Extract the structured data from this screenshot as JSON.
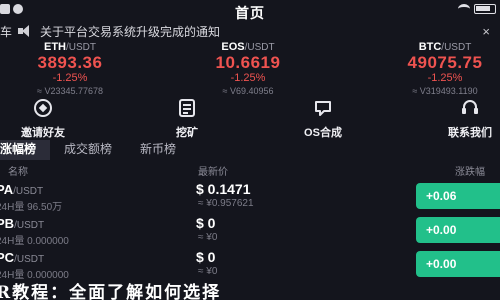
{
  "header": {
    "title": "首页"
  },
  "notice": {
    "prefix": "车",
    "text": "关于平台交易系统升级完成的通知"
  },
  "ticker": [
    {
      "base": "ETH",
      "quote": "/USDT",
      "price": "3893.36",
      "change": "-1.25%",
      "volume": "≈ V23345.77678"
    },
    {
      "base": "EOS",
      "quote": "/USDT",
      "price": "10.6619",
      "change": "-1.25%",
      "volume": "≈ V69.40956"
    },
    {
      "base": "BTC",
      "quote": "/USDT",
      "price": "49075.75",
      "change": "-1.25%",
      "volume": "≈ V319493.1190"
    }
  ],
  "shortcuts": [
    {
      "label": "邀请好友",
      "icon": "invite-icon"
    },
    {
      "label": "挖矿",
      "icon": "mining-icon"
    },
    {
      "label": "OS合成",
      "icon": "synthesis-icon"
    },
    {
      "label": "联系我们",
      "icon": "contact-icon"
    }
  ],
  "tabs": [
    {
      "label": "涨幅榜",
      "active": true
    },
    {
      "label": "成交额榜",
      "active": false
    },
    {
      "label": "新币榜",
      "active": false
    }
  ],
  "list_header": {
    "name": "名称",
    "price": "最新价",
    "change": "涨跌幅"
  },
  "rows": [
    {
      "name": "PA",
      "quote": "/USDT",
      "volume": "24H量 96.50万",
      "price": "$ 0.1471",
      "cny": "≈ ¥0.957621",
      "change": "+0.06"
    },
    {
      "name": "PB",
      "quote": "/USDT",
      "volume": "24H量 0.000000",
      "price": "$ 0",
      "cny": "≈ ¥0",
      "change": "+0.00"
    },
    {
      "name": "PC",
      "quote": "/USDT",
      "volume": "24H量 0.000000",
      "price": "$ 0",
      "cny": "≈ ¥0",
      "change": "+0.00"
    }
  ],
  "bottom_title": "R教程：全面了解如何选择",
  "colors": {
    "background": "#14151d",
    "down": "#ef5350",
    "up": "#22c08a"
  }
}
